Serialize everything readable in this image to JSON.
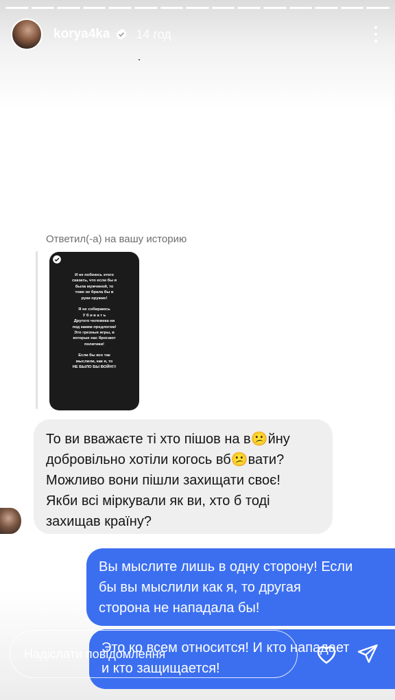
{
  "progress": {
    "segments": 15
  },
  "header": {
    "username": "korya4ka",
    "time": "14 год",
    "verified_icon": "verified-badge-icon",
    "more_icon": "more-vertical-icon"
  },
  "reply": {
    "label": "Ответил(-а) на вашу историю",
    "story_text": "И не побоюсь этого\nсказать, что если бы я\nбыла мужчиной, то\nтоже не брала бы в\nруки оружие!\n\nЯ не собираюсь\nУ б и в а т ь\nДругого человека ни\nпод каким предлогом!\nЭто грезные игры, в\nкоторые нас бросают\nполитики!\n\nЕсли бы все так\nмыслили, как я, то\nНЕ БЫЛО БЫ ВОЙН!!!"
  },
  "messages": {
    "received": "То ви вважаєте ті хто пішов на в😕йну\nдобровільно хотіли когось вб😕вати?\nМожливо вони пішли захищати своє!\nЯкби всі міркували як ви, хто б тоді\nзахищав країну?",
    "sent_1": "Вы мыслите лишь в одну сторону! Если\nбы вы мыслили как я, то другая\nсторона не нападала бы!",
    "sent_2": "Это ко всем относится! И кто нападает\nи кто защищается!"
  },
  "composer": {
    "placeholder": "Надіслати повідомлення"
  },
  "colors": {
    "sent_bubble": "#3c6ff0",
    "received_bubble": "#efefef"
  }
}
